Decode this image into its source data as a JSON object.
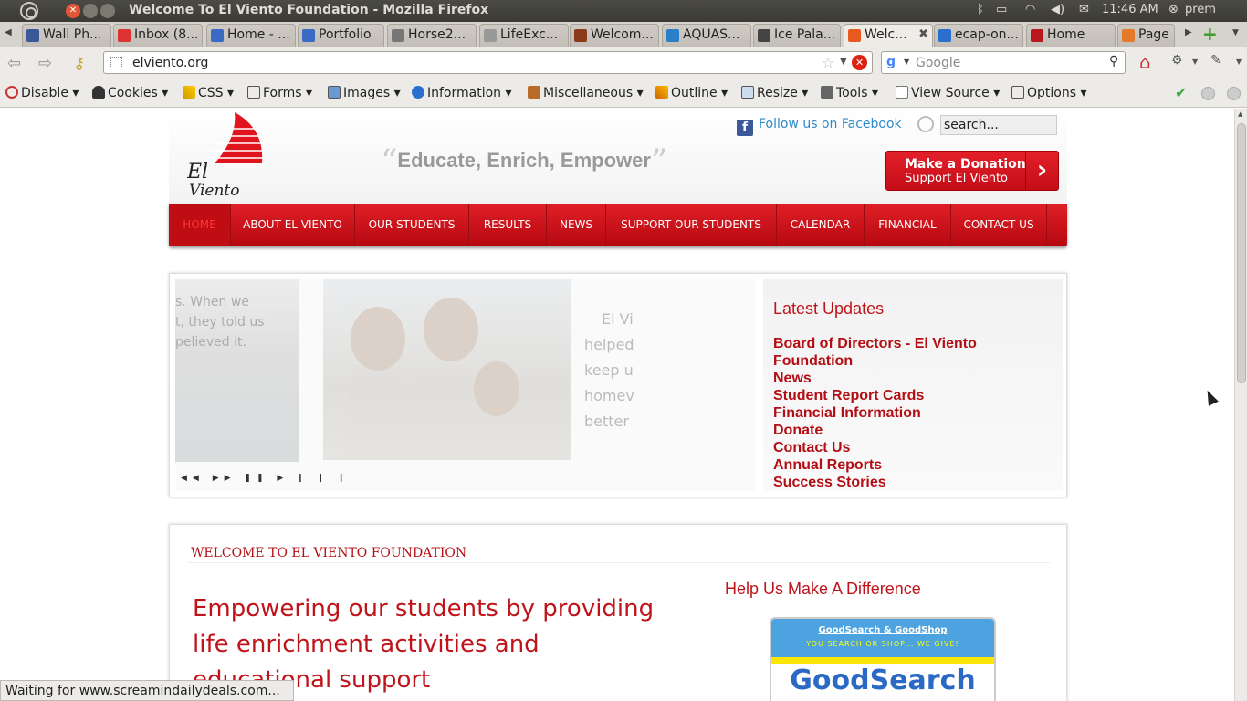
{
  "os": {
    "window_title": "Welcome To El Viento Foundation - Mozilla Firefox",
    "time": "11:46 AM",
    "user": "prem"
  },
  "tabs": [
    {
      "label": "Wall Ph...",
      "color": "#3b5998"
    },
    {
      "label": "Inbox (8...",
      "color": "#d33"
    },
    {
      "label": "Home - ...",
      "color": "#3a6bc4"
    },
    {
      "label": "Portfolio",
      "color": "#3a6bc4"
    },
    {
      "label": "Horse2...",
      "color": "#777"
    },
    {
      "label": "LifeExc...",
      "color": "#999"
    },
    {
      "label": "Welcom...",
      "color": "#8b3a1a"
    },
    {
      "label": "AQUAS...",
      "color": "#2a7fc9"
    },
    {
      "label": "Ice Pala...",
      "color": "#444"
    },
    {
      "label": "Welc...",
      "color": "#e85a20"
    },
    {
      "label": "ecap-on...",
      "color": "#2a6fcf"
    },
    {
      "label": "Home",
      "color": "#b8171e"
    },
    {
      "label": "Page r",
      "color": "#e57a2a"
    }
  ],
  "nav": {
    "url": "elviento.org",
    "search_placeholder": "Google"
  },
  "webdev": {
    "items": [
      "Disable",
      "Cookies",
      "CSS",
      "Forms",
      "Images",
      "Information",
      "Miscellaneous",
      "Outline",
      "Resize",
      "Tools",
      "View Source",
      "Options"
    ]
  },
  "site": {
    "tagline": "Educate, Enrich, Empower",
    "facebook": "Follow us on Facebook",
    "search_value": "search...",
    "donate_line1": "Make a Donation",
    "donate_line2": "Support El Viento",
    "menu": [
      "HOME",
      "ABOUT EL VIENTO",
      "OUR STUDENTS",
      "RESULTS",
      "NEWS",
      "SUPPORT OUR STUDENTS",
      "CALENDAR",
      "FINANCIAL",
      "CONTACT US"
    ],
    "slide_text_left": [
      "s.  When we",
      "t, they told us",
      "pelieved it."
    ],
    "slide_text_right": [
      "El Vi",
      "helped",
      "keep u",
      "homev",
      "better"
    ],
    "updates_title": "Latest Updates",
    "updates": [
      "Board of Directors - El Viento Foundation",
      "News",
      "Student Report Cards",
      "Financial Information",
      "Donate",
      "Contact Us",
      "Annual Reports",
      "Success Stories"
    ],
    "welcome_title": "WELCOME TO EL VIENTO FOUNDATION",
    "welcome_text": "Empowering our students by providing life enrichment activities and educational support",
    "help_title": "Help Us Make A Difference",
    "gs_line1": "GoodSearch & GoodShop",
    "gs_line2": "YOU SEARCH OR SHOP... WE GIVE!",
    "gs_logo": "GoodSearch"
  },
  "status": "Waiting for www.screamindailydeals.com..."
}
